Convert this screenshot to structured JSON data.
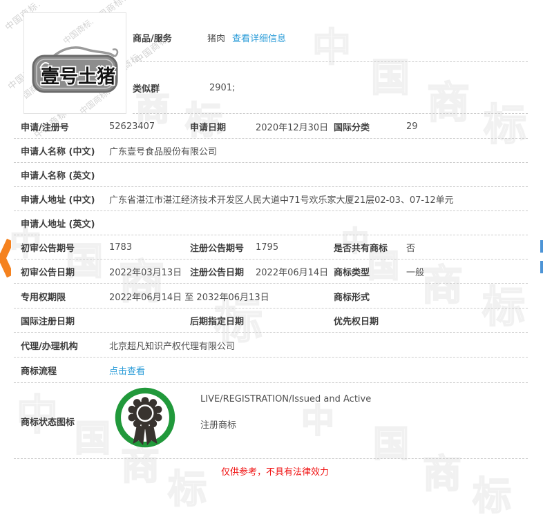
{
  "logo": {
    "text": "壹号土猪"
  },
  "header": {
    "goods_label": "商品/服务",
    "goods_value": "猪肉",
    "goods_link": "查看详细信息",
    "similar_label": "类似群",
    "similar_value": "2901;"
  },
  "fields": {
    "reg_no_label": "申请/注册号",
    "reg_no": "52623407",
    "apply_date_label": "申请日期",
    "apply_date": "2020年12月30日",
    "intl_class_label": "国际分类",
    "intl_class": "29",
    "name_cn_label": "申请人名称 (中文)",
    "name_cn": "广东壹号食品股份有限公司",
    "name_en_label": "申请人名称 (英文)",
    "name_en": "",
    "addr_cn_label": "申请人地址 (中文)",
    "addr_cn": "广东省湛江市湛江经济技术开发区人民大道中71号欢乐家大厦21层02-03、07-12单元",
    "addr_en_label": "申请人地址 (英文)",
    "addr_en": "",
    "first_pub_no_label": "初审公告期号",
    "first_pub_no": "1783",
    "reg_pub_no_label": "注册公告期号",
    "reg_pub_no": "1795",
    "shared_label": "是否共有商标",
    "shared": "否",
    "first_pub_date_label": "初审公告日期",
    "first_pub_date": "2022年03月13日",
    "reg_pub_date_label": "注册公告日期",
    "reg_pub_date": "2022年06月14日",
    "tm_type_label": "商标类型",
    "tm_type": "一般",
    "right_period_label": "专用权期限",
    "right_period": "2022年06月14日 至 2032年06月13日",
    "tm_form_label": "商标形式",
    "tm_form": "",
    "intl_reg_date_label": "国际注册日期",
    "intl_reg_date": "",
    "later_date_label": "后期指定日期",
    "later_date": "",
    "priority_date_label": "优先权日期",
    "priority_date": "",
    "agency_label": "代理/办理机构",
    "agency": "北京超凡知识产权代理有限公司",
    "process_label": "商标流程",
    "process_link": "点击查看",
    "status_label": "商标状态图标",
    "status_line1": "LIVE/REGISTRATION/Issued and Active",
    "status_line2": "注册商标"
  },
  "footer": {
    "disclaimer": "仅供参考，不具有法律效力"
  },
  "watermark": {
    "text": "中国商标",
    "chars": [
      "中",
      "国",
      "商",
      "标"
    ],
    "script_text": "中国商标."
  },
  "colors": {
    "link": "#2b9cd8",
    "accent_orange": "#f5821f",
    "status_green": "#21993b",
    "disclaimer_red": "#f01010",
    "blue_bar": "#4d94d6"
  }
}
